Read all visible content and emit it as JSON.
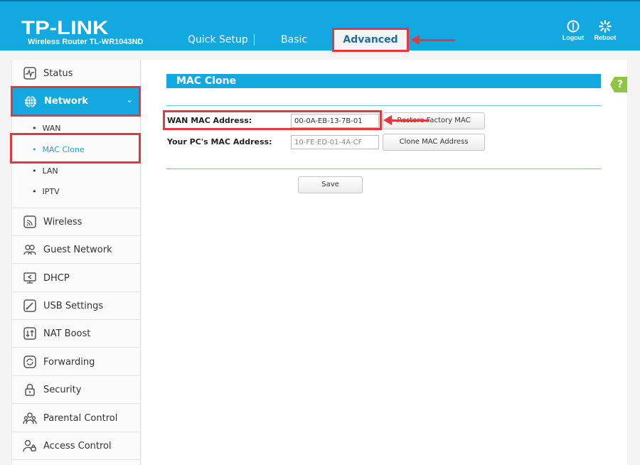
{
  "header": {
    "brand": "TP-LINK",
    "model": "Wireless Router TL-WR1043ND",
    "nav": [
      {
        "label": "Quick Setup"
      },
      {
        "label": "Basic"
      },
      {
        "label": "Advanced",
        "active": true
      }
    ],
    "actions": [
      {
        "label": "Logout",
        "icon": "power-icon"
      },
      {
        "label": "Reboot",
        "icon": "reboot-icon"
      }
    ]
  },
  "sidebar": {
    "items": [
      {
        "label": "Status",
        "icon": "status-icon"
      },
      {
        "label": "Network",
        "icon": "globe-icon",
        "active": true,
        "expanded": true
      },
      {
        "label": "Wireless",
        "icon": "wireless-icon"
      },
      {
        "label": "Guest Network",
        "icon": "guest-network-icon"
      },
      {
        "label": "DHCP",
        "icon": "dhcp-icon"
      },
      {
        "label": "USB Settings",
        "icon": "usb-icon"
      },
      {
        "label": "NAT Boost",
        "icon": "nat-boost-icon"
      },
      {
        "label": "Forwarding",
        "icon": "forwarding-icon"
      },
      {
        "label": "Security",
        "icon": "lock-icon"
      },
      {
        "label": "Parental Control",
        "icon": "parental-control-icon"
      },
      {
        "label": "Access Control",
        "icon": "access-control-icon"
      }
    ],
    "network_sub": [
      {
        "label": "WAN"
      },
      {
        "label": "MAC Clone",
        "active": true
      },
      {
        "label": "LAN"
      },
      {
        "label": "IPTV"
      }
    ]
  },
  "main": {
    "title": "MAC Clone",
    "help_label": "?",
    "wan_mac_label": "WAN MAC Address:",
    "wan_mac_value": "00-0A-EB-13-7B-01",
    "restore_button": "Restore Factory MAC",
    "pc_mac_label": "Your PC's MAC Address:",
    "pc_mac_value": "10-FE-ED-01-4A-CF",
    "clone_button": "Clone MAC Address",
    "save_button": "Save"
  },
  "colors": {
    "brand_blue": "#14a8e0",
    "highlight_red": "#e4393c",
    "help_green": "#8ec63f",
    "active_link": "#1ba3d6"
  }
}
